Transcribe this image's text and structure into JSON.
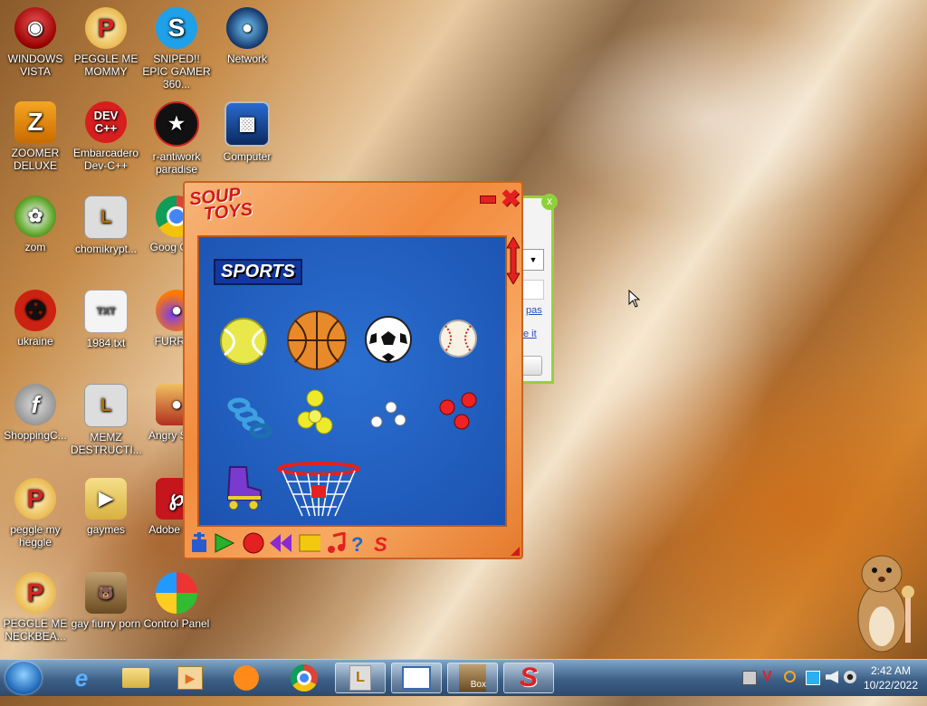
{
  "desktop": {
    "icons": [
      {
        "label": "WINDOWS VISTA",
        "icon": "vista-helmet-icon"
      },
      {
        "label": "PEGGLE ME MOMMY",
        "icon": "peggle-icon"
      },
      {
        "label": "SNIPED!! EPIC GAMER 360...",
        "icon": "skype-icon"
      },
      {
        "label": "Network",
        "icon": "network-icon"
      },
      {
        "label": "ZOOMER DELUXE",
        "icon": "zoomer-icon"
      },
      {
        "label": "Embarcadero Dev-C++",
        "icon": "devcpp-icon"
      },
      {
        "label": "r-antiwork paradise",
        "icon": "antiwork-icon"
      },
      {
        "label": "Computer",
        "icon": "computer-icon"
      },
      {
        "label": "zom",
        "icon": "flower-icon"
      },
      {
        "label": "chomikrypt...",
        "icon": "lnk-file-icon"
      },
      {
        "label": "Goog Chro",
        "icon": "chrome-icon"
      },
      {
        "label": "ukraine",
        "icon": "radiation-icon"
      },
      {
        "label": "1984.txt",
        "icon": "text-file-icon"
      },
      {
        "label": "FURRYF",
        "icon": "firefox-icon"
      },
      {
        "label": "ShoppingC...",
        "icon": "flash-icon"
      },
      {
        "label": "MEMZ DESTRUCTI...",
        "icon": "lnk-file-icon"
      },
      {
        "label": "Angry Seas",
        "icon": "angry-birds-icon"
      },
      {
        "label": "peggle my heggle",
        "icon": "peggle-icon"
      },
      {
        "label": "gaymes",
        "icon": "folder-icon"
      },
      {
        "label": "Adobe R XI",
        "icon": "acrobat-icon"
      },
      {
        "label": "PEGGLE ME NECKBEA...",
        "icon": "peggle-icon"
      },
      {
        "label": "gay fiurry porn",
        "icon": "bonzi-box-icon"
      },
      {
        "label": "Control Panel",
        "icon": "control-panel-icon"
      }
    ]
  },
  "soup_window": {
    "logo_line1": "SOUP",
    "logo_line2": "TOYS",
    "category": "SPORTS",
    "toys": [
      "tennis-ball",
      "basketball",
      "soccer-ball",
      "baseball",
      "spring",
      "yellow-balls",
      "white-balls",
      "red-balls",
      "roller-skate",
      "basketball-hoop"
    ],
    "toolbar": [
      "pump-tool",
      "play-tool",
      "record-tool",
      "rewind-tool",
      "stop-tool",
      "music-tool",
      "help-tool",
      "soup-logo-tool"
    ],
    "colors": {
      "frame": "#f28a3c",
      "area": "#1c52b0",
      "accent": "#e42020"
    }
  },
  "background_panel": {
    "close_label": "x",
    "link1": "pas",
    "link2": "e it"
  },
  "taskbar": {
    "time": "2:42 AM",
    "date": "10/22/2022",
    "pinned": [
      "ie-icon",
      "explorer-icon",
      "media-player-icon",
      "uc-browser-icon",
      "chrome-icon",
      "lnk-app-icon",
      "notepad-window-icon",
      "bonzi-box-icon",
      "soup-toys-icon"
    ],
    "box_label": "Box"
  }
}
